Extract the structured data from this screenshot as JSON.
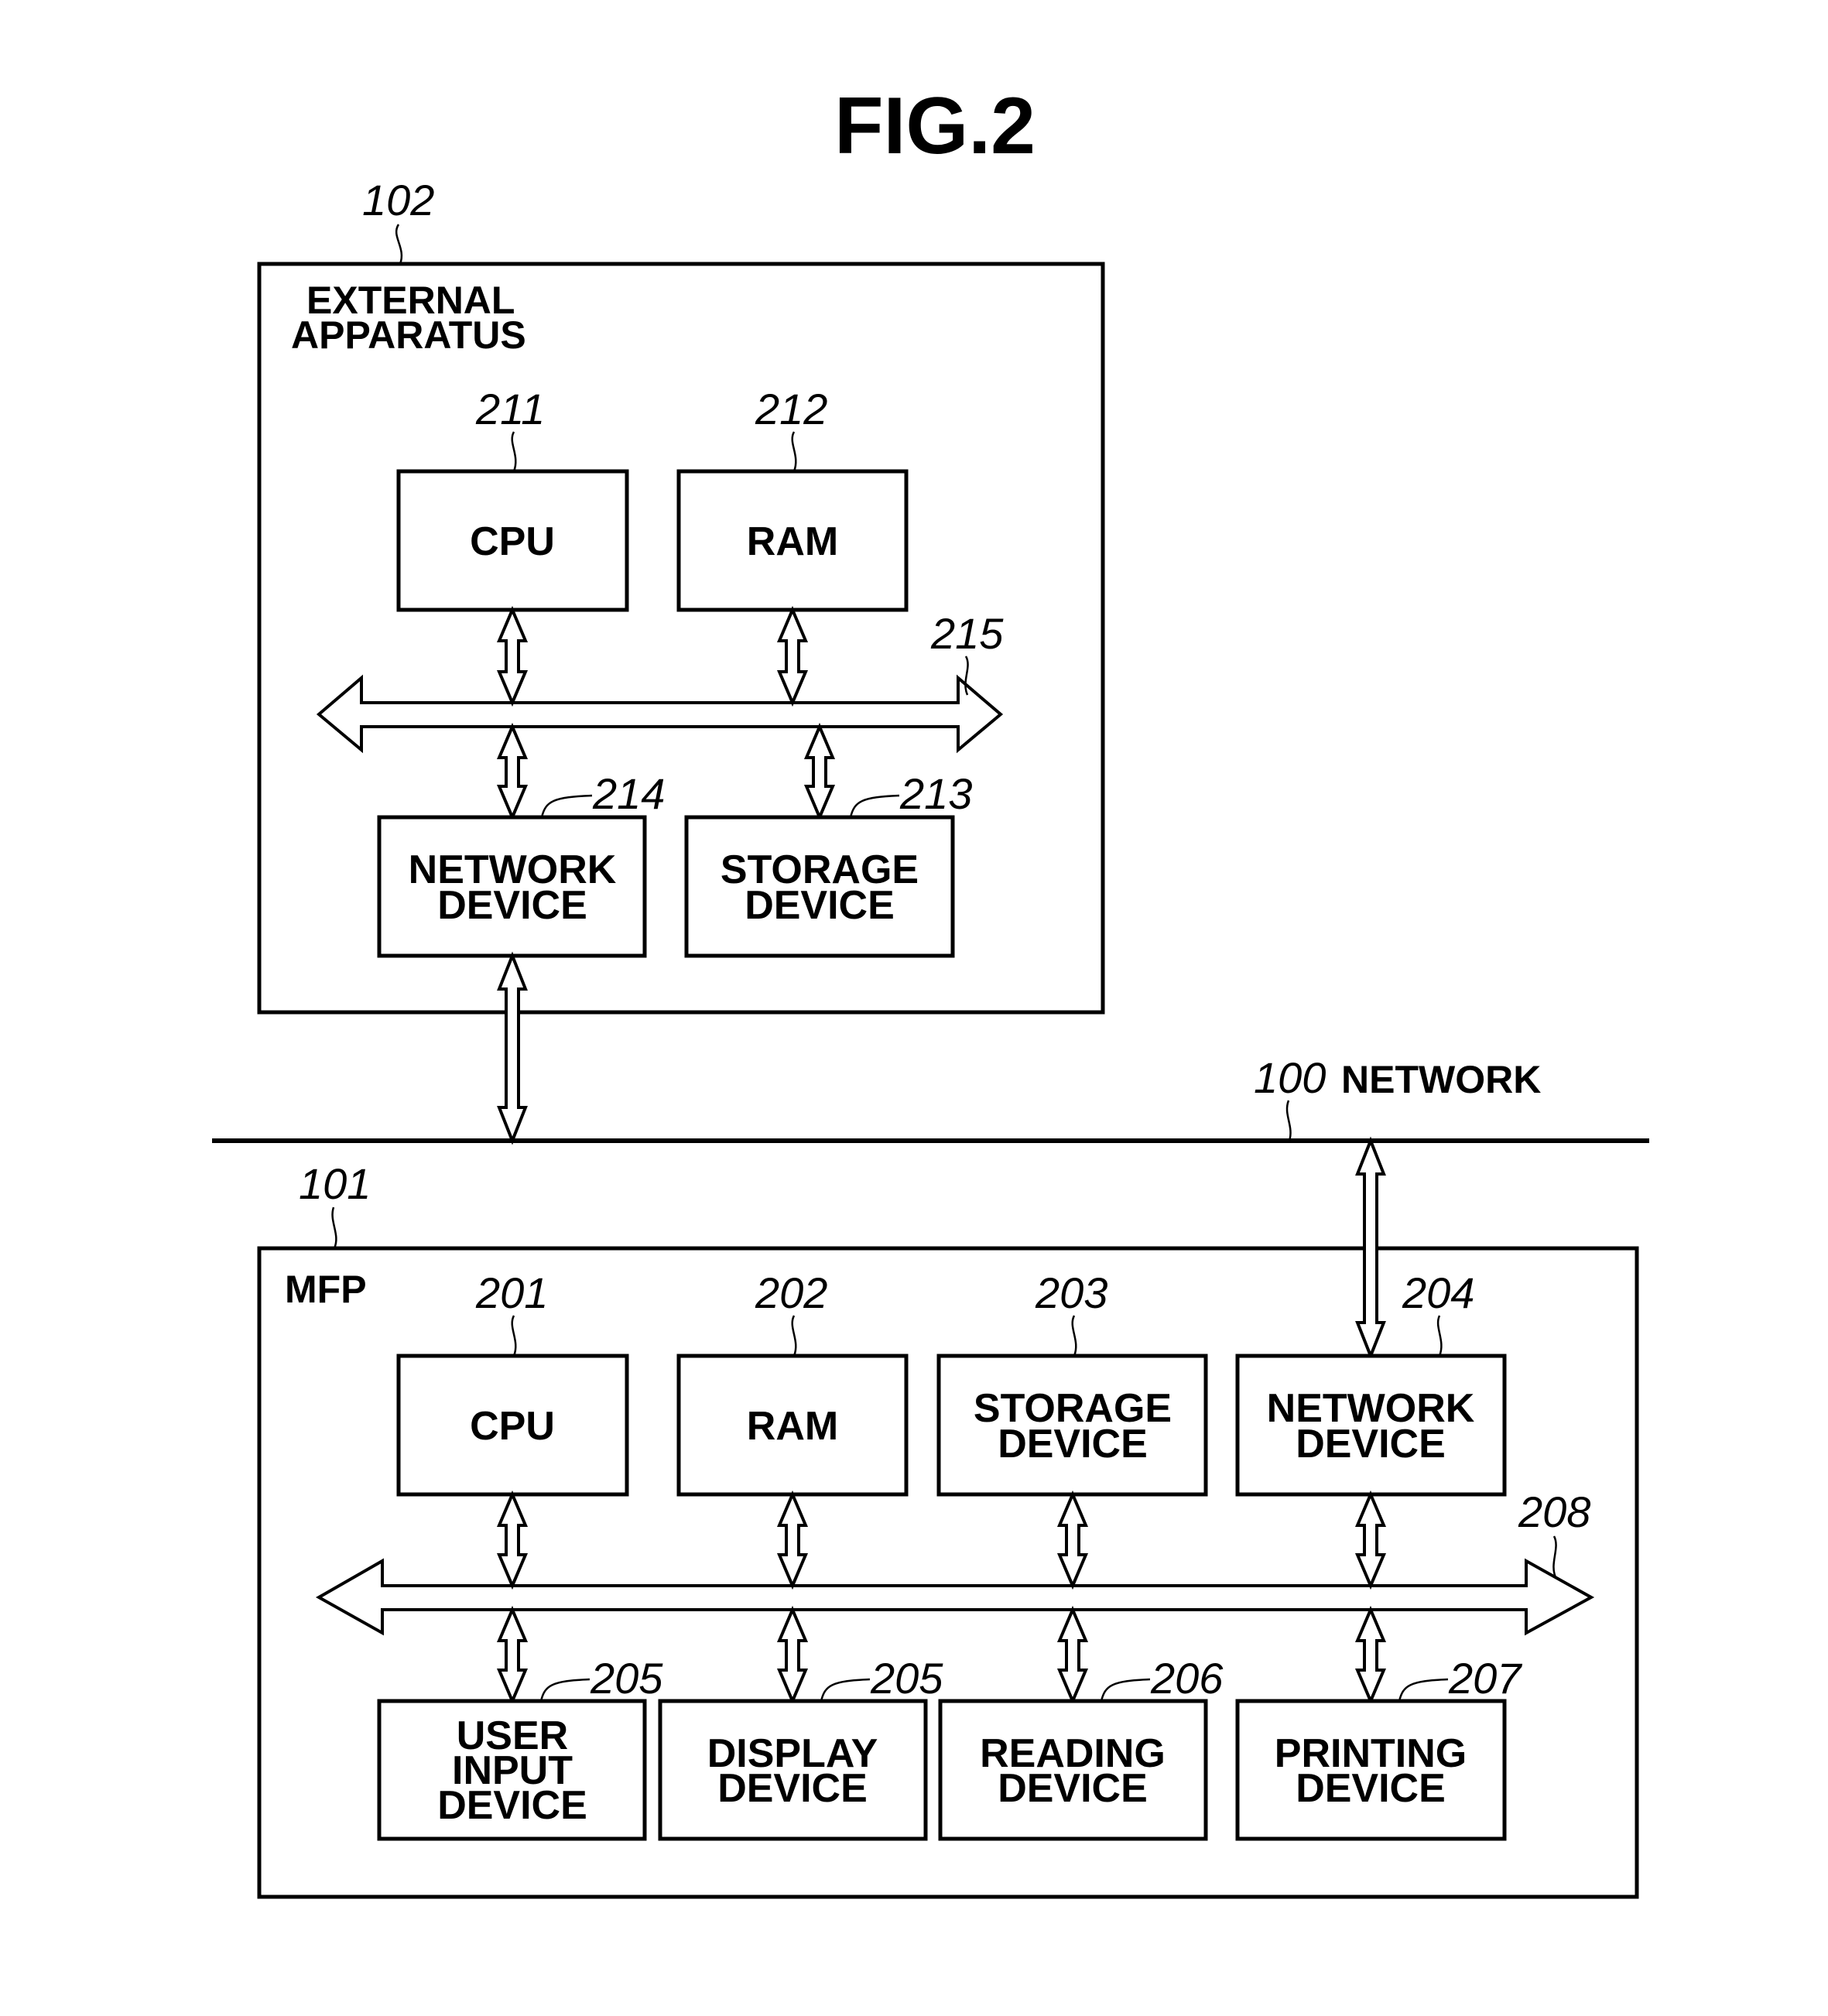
{
  "figure": {
    "title": "FIG.2"
  },
  "external_apparatus": {
    "ref": "102",
    "label_line1": "EXTERNAL",
    "label_line2": "APPARATUS",
    "bus_ref": "215",
    "blocks": [
      {
        "ref": "211",
        "lines": [
          "CPU"
        ]
      },
      {
        "ref": "212",
        "lines": [
          "RAM"
        ]
      },
      {
        "ref": "214",
        "lines": [
          "NETWORK",
          "DEVICE"
        ]
      },
      {
        "ref": "213",
        "lines": [
          "STORAGE",
          "DEVICE"
        ]
      }
    ]
  },
  "network": {
    "ref": "100",
    "label": "NETWORK"
  },
  "mfp": {
    "ref": "101",
    "label": "MFP",
    "bus_ref": "208",
    "top_blocks": [
      {
        "ref": "201",
        "lines": [
          "CPU"
        ]
      },
      {
        "ref": "202",
        "lines": [
          "RAM"
        ]
      },
      {
        "ref": "203",
        "lines": [
          "STORAGE",
          "DEVICE"
        ]
      },
      {
        "ref": "204",
        "lines": [
          "NETWORK",
          "DEVICE"
        ]
      }
    ],
    "bottom_blocks": [
      {
        "ref": "205",
        "lines": [
          "USER",
          "INPUT",
          "DEVICE"
        ]
      },
      {
        "ref": "205",
        "lines": [
          "DISPLAY",
          "DEVICE"
        ]
      },
      {
        "ref": "206",
        "lines": [
          "READING",
          "DEVICE"
        ]
      },
      {
        "ref": "207",
        "lines": [
          "PRINTING",
          "DEVICE"
        ]
      }
    ]
  }
}
